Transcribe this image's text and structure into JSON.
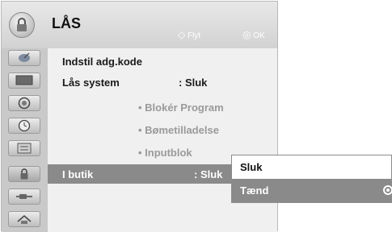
{
  "menu": {
    "title": "LÅS",
    "hint_move_symbol": "◇",
    "hint_move_label": "Flyt",
    "hint_ok_symbol": "◎",
    "hint_ok_label": "OK"
  },
  "sidebar": {
    "items": [
      {
        "icon": "satellite-dish-icon"
      },
      {
        "icon": "screen-icon"
      },
      {
        "icon": "speaker-icon"
      },
      {
        "icon": "clock-icon"
      },
      {
        "icon": "option-icon"
      },
      {
        "icon": "lock-icon"
      },
      {
        "icon": "input-plug-icon"
      },
      {
        "icon": "usb-icon"
      }
    ]
  },
  "rows": [
    {
      "label": "Indstil adg.kode",
      "value": ""
    },
    {
      "label": "Lås system",
      "value": ": Sluk"
    },
    {
      "label": "• Blokér Program",
      "value": ""
    },
    {
      "label": "• Bømetilladelse",
      "value": ""
    },
    {
      "label": "• Inputblok",
      "value": ""
    },
    {
      "label": "I butik",
      "value": ": Sluk"
    }
  ],
  "popup": {
    "options": [
      {
        "label": "Sluk"
      },
      {
        "label": "Tænd"
      }
    ]
  },
  "colors": {
    "highlight": "#8a8a8a",
    "disabled_text": "#9a9a9a"
  }
}
